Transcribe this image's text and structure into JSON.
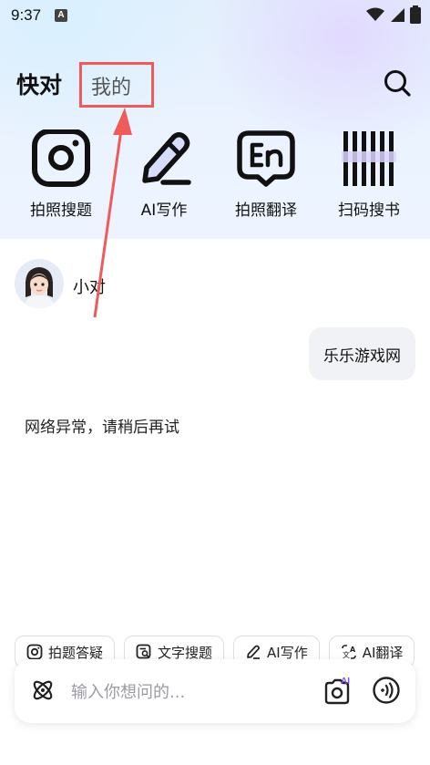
{
  "status": {
    "time": "9:37",
    "notif": "A"
  },
  "header": {
    "title": "快对",
    "tab_mine": "我的"
  },
  "tools": [
    {
      "label": "拍照搜题",
      "icon": "camera-lens-icon"
    },
    {
      "label": "AI写作",
      "icon": "pencil-icon"
    },
    {
      "label": "拍照翻译",
      "icon": "translate-en-icon"
    },
    {
      "label": "扫码搜书",
      "icon": "barcode-icon"
    }
  ],
  "chat": {
    "bot_name": "小对",
    "user_message": "乐乐游戏网",
    "bot_message": "网络异常，请稍后再试"
  },
  "chips": [
    "拍题答疑",
    "文字搜题",
    "AI写作",
    "AI翻译"
  ],
  "input": {
    "placeholder": "输入你想问的...",
    "camera_badge": "AI"
  },
  "colors": {
    "accent_red": "#ef5a5a",
    "brand_purple": "#7b4dff"
  }
}
